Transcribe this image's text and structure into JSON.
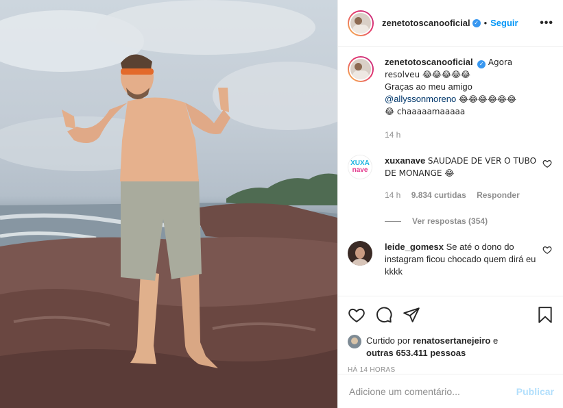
{
  "header": {
    "username": "zenetotoscanooficial",
    "separator": "•",
    "follow_label": "Seguir",
    "more_label": "•••"
  },
  "caption": {
    "username": "zenetotoscanooficial",
    "line1": "Agora resolveu 😂😂😂😂😂",
    "line2": "Graças ao meu amigo",
    "mention": "@allyssonmoreno",
    "line3": "😂😂😂😂😂😂",
    "line4": "😂 chaaaaamaaaaa",
    "time": "14 h"
  },
  "comments": [
    {
      "username": "xuxanave",
      "avatar_text": [
        "XUXA",
        "nave"
      ],
      "text": "SAUDADE DE VER O TUBO DE MONANGE 😂",
      "time": "14 h",
      "likes": "9.834 curtidas",
      "reply": "Responder",
      "view_replies": "Ver respostas (354)"
    },
    {
      "username": "leide_gomesx",
      "text": "Se até o dono do instagram ficou chocado quem dirá eu kkkk"
    }
  ],
  "liked_by": {
    "prefix": "Curtido por",
    "user": "renatosertanejeiro",
    "connector": "e",
    "others": "outras 653.411 pessoas"
  },
  "timestamp": "HÁ 14 HORAS",
  "add_comment": {
    "placeholder": "Adicione um comentário...",
    "publish_label": "Publicar"
  },
  "colors": {
    "accent": "#0095f6",
    "publish_disabled": "#b2dffc",
    "muted": "#8e8e8e",
    "verified": "#3897f0"
  },
  "icons": [
    "verified-icon",
    "more-icon",
    "heart-icon",
    "comment-icon",
    "share-icon",
    "save-icon"
  ]
}
